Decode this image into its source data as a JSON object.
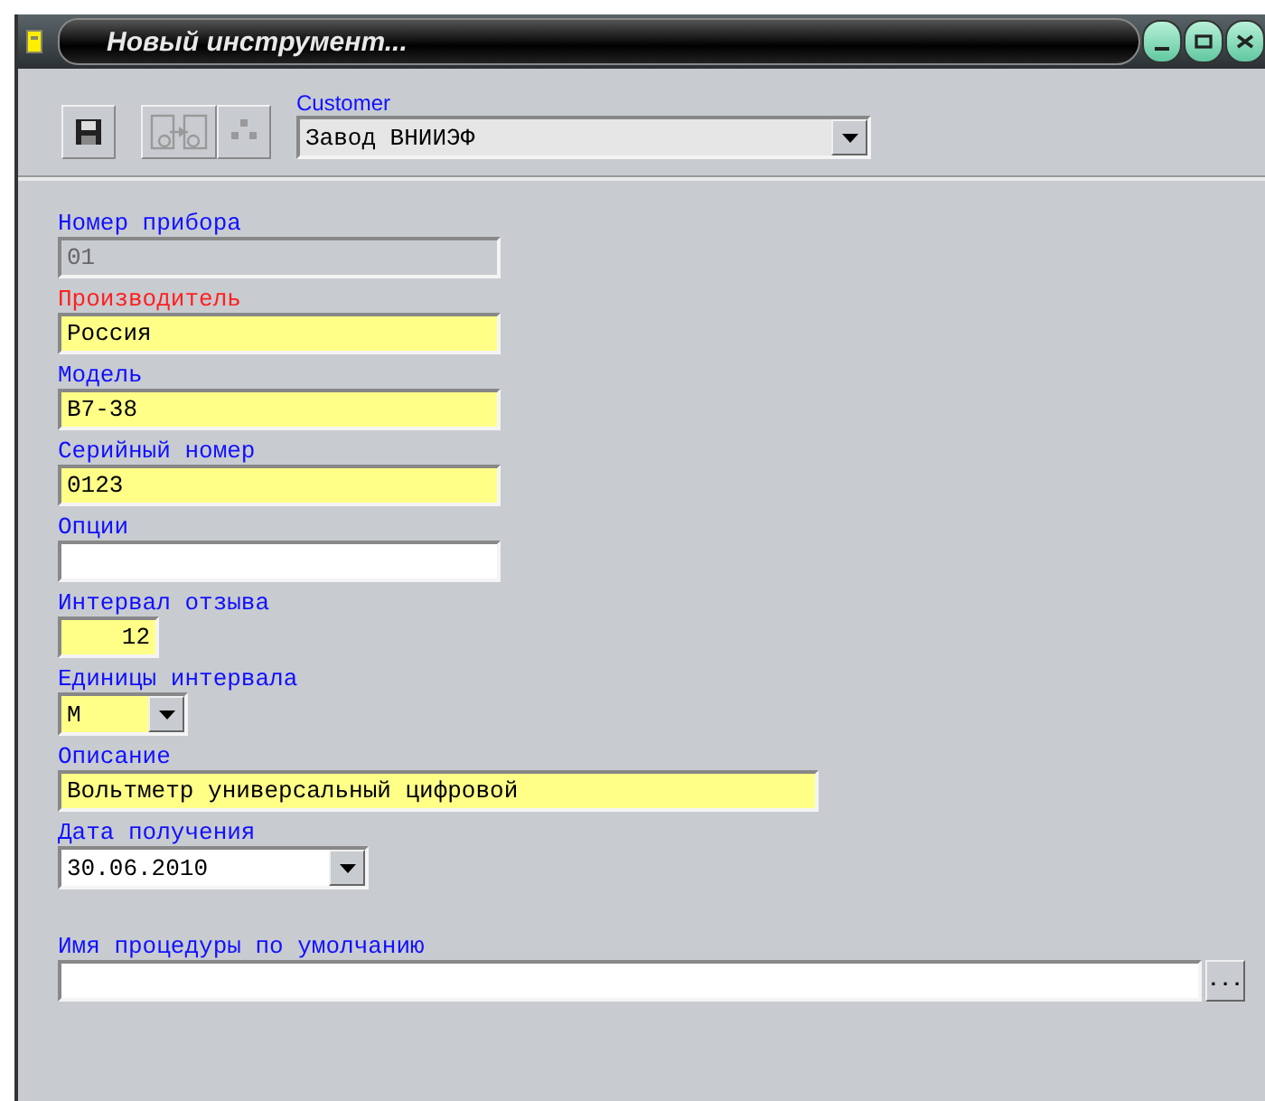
{
  "window": {
    "title": "Новый инструмент..."
  },
  "toolbar": {
    "customer_label": "Customer",
    "customer_value": "Завод ВНИИЭФ"
  },
  "fields": [
    {
      "label": "Номер прибора",
      "color": "#1010ff",
      "kind": "text",
      "value": "01",
      "disabled": true,
      "highlighted": false
    },
    {
      "label": "Производитель",
      "color": "#ff2020",
      "kind": "text",
      "value": "Россия",
      "disabled": false,
      "highlighted": true
    },
    {
      "label": "Модель",
      "color": "#1010ff",
      "kind": "text",
      "value": "B7-38",
      "disabled": false,
      "highlighted": true
    },
    {
      "label": "Серийный номер",
      "color": "#1010ff",
      "kind": "text",
      "value": "0123",
      "disabled": false,
      "highlighted": true
    },
    {
      "label": "Опции",
      "color": "#1010ff",
      "kind": "text",
      "disabled": false,
      "highlighted": false
    },
    {
      "label": "Интервал отзыва",
      "color": "#1010ff",
      "kind": "number",
      "value": "12",
      "disabled": false,
      "highlighted": true
    },
    {
      "label": "Единицы интервала",
      "color": "#1010ff",
      "kind": "unitcombo",
      "value": "M",
      "disabled": false,
      "highlighted": true
    },
    {
      "label": "Описание",
      "color": "#1010ff",
      "kind": "longtext",
      "value": "Вольтметр универсальный цифровой",
      "disabled": false,
      "highlighted": true
    },
    {
      "label": "Дата получения",
      "color": "#1010ff",
      "kind": "datecombo",
      "value": "30.06.2010",
      "disabled": false,
      "highlighted": false
    },
    {
      "label": "Имя процедуры по умолчанию",
      "color": "#1010ff",
      "kind": "browse",
      "browse_label": "...",
      "disabled": false,
      "highlighted": false
    }
  ]
}
